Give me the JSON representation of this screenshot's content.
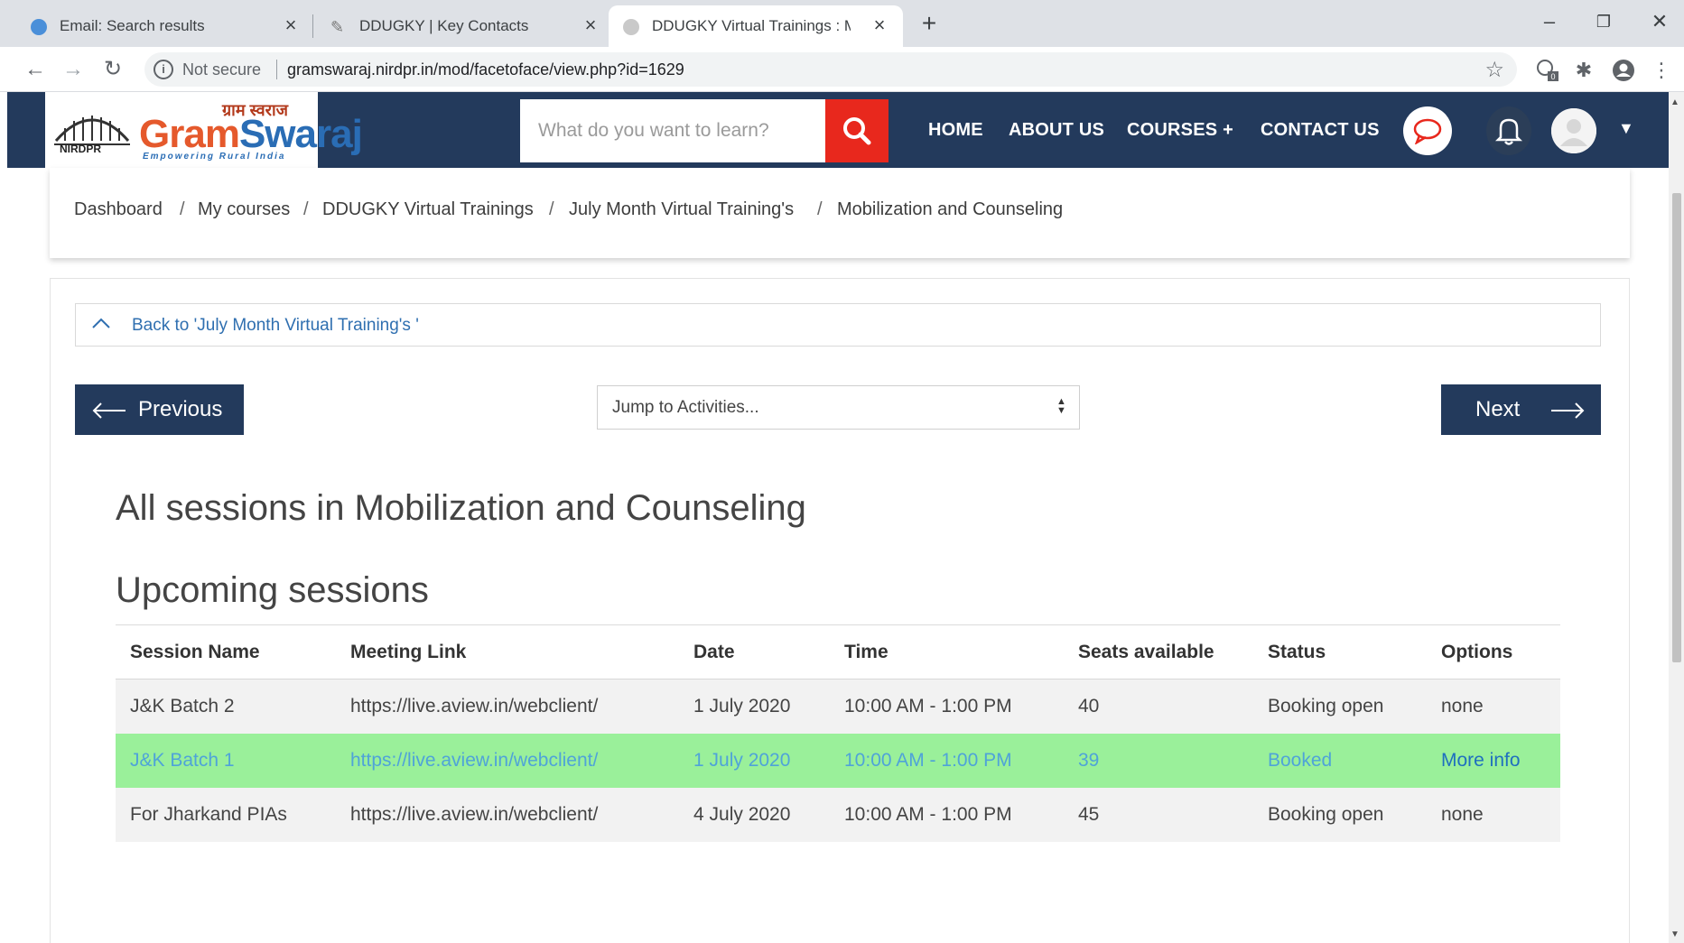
{
  "browser": {
    "tabs": [
      {
        "title": "Email: Search results",
        "active": false
      },
      {
        "title": "DDUGKY | Key Contacts",
        "active": false
      },
      {
        "title": "DDUGKY Virtual Trainings : Mobi",
        "active": true
      }
    ],
    "security_label": "Not secure",
    "url": "gramswaraj.nirdpr.in/mod/facetoface/view.php?id=1629",
    "extension_badge": "0"
  },
  "site": {
    "logo": {
      "hindi": "ग्राम स्वराज",
      "brand_part1": "Gram",
      "brand_part2": "Swaraj",
      "tagline": "Empowering Rural India",
      "emblem_label": "NIRDPR"
    },
    "search_placeholder": "What do you want to learn?",
    "nav": {
      "home": "HOME",
      "about": "ABOUT US",
      "courses": "COURSES +",
      "contact": "CONTACT US"
    },
    "colors": {
      "header": "#233a5c",
      "search_button": "#e8281d",
      "booked_row": "#9af09a",
      "link": "#2f6fb0"
    }
  },
  "breadcrumb": {
    "items": [
      "Dashboard",
      "My courses",
      "DDUGKY Virtual Trainings",
      "July Month Virtual Training's",
      "Mobilization and Counseling"
    ],
    "separator": "/"
  },
  "activity_nav": {
    "back_link": "Back to 'July Month Virtual Training's '",
    "previous": "Previous",
    "next": "Next",
    "jump_label": "Jump to Activities..."
  },
  "main": {
    "title": "All sessions in Mobilization and Counseling",
    "subtitle": "Upcoming sessions",
    "table": {
      "columns": [
        "Session Name",
        "Meeting Link",
        "Date",
        "Time",
        "Seats available",
        "Status",
        "Options"
      ],
      "rows": [
        {
          "session": "J&K Batch 2",
          "link": "https://live.aview.in/webclient/",
          "date": "1 July 2020",
          "time": "10:00 AM - 1:00 PM",
          "seats": "40",
          "status": "Booking open",
          "options": "none",
          "booked": false
        },
        {
          "session": "J&K Batch 1",
          "link": "https://live.aview.in/webclient/",
          "date": "1 July 2020",
          "time": "10:00 AM - 1:00 PM",
          "seats": "39",
          "status": "Booked",
          "options": "More info",
          "booked": true
        },
        {
          "session": "For Jharkand PIAs",
          "link": "https://live.aview.in/webclient/",
          "date": "4 July 2020",
          "time": "10:00 AM - 1:00 PM",
          "seats": "45",
          "status": "Booking open",
          "options": "none",
          "booked": false
        }
      ]
    }
  }
}
